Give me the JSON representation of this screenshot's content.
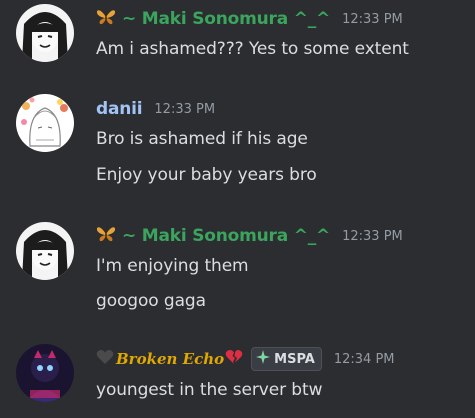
{
  "messages": [
    {
      "author": "~ Maki Sonomura ^_^",
      "author_color": "#3ba55d",
      "author_emoji": "butterfly-icon",
      "time": "12:33 PM",
      "lines": [
        "Am i ashamed??? Yes to some extent"
      ]
    },
    {
      "author": "danii",
      "author_color": "#a2c4f5",
      "time": "12:33 PM",
      "lines": [
        "Bro is ashamed if his age",
        "Enjoy your baby years bro"
      ]
    },
    {
      "author": "~ Maki Sonomura ^_^",
      "author_color": "#3ba55d",
      "author_emoji": "butterfly-icon",
      "time": "12:33 PM",
      "lines": [
        "I'm enjoying them",
        "googoo gaga"
      ]
    },
    {
      "author": "Broken Echo",
      "author_color": "#e0a800",
      "author_prefix_icon": "black-heart-icon",
      "author_suffix_icon": "broken-heart-icon",
      "tag": "MSPA",
      "time": "12:34 PM",
      "lines": [
        "youngest in the server btw"
      ]
    }
  ]
}
